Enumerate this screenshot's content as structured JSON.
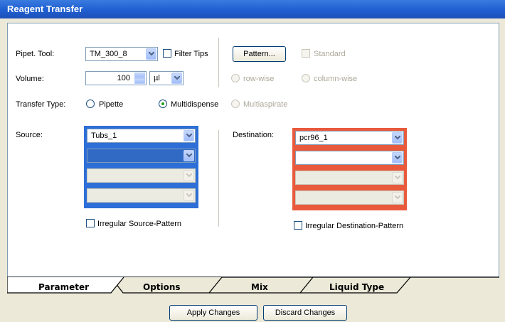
{
  "window": {
    "title": "Reagent Transfer"
  },
  "pipet_tool": {
    "label": "Pipet. Tool:",
    "value": "TM_300_8",
    "filter_tips_label": "Filter Tips"
  },
  "volume": {
    "label": "Volume:",
    "value": "100",
    "unit": "µl"
  },
  "pattern": {
    "button_label": "Pattern...",
    "standard_label": "Standard",
    "row_wise_label": "row-wise",
    "column_wise_label": "column-wise"
  },
  "transfer_type": {
    "label": "Transfer Type:",
    "pipette": "Pipette",
    "multidispense": "Multidispense",
    "multiaspirate": "Multiaspirate",
    "selected": "Multidispense"
  },
  "source": {
    "label": "Source:",
    "values": [
      "Tubs_1",
      "",
      "",
      ""
    ],
    "irregular_label": "Irregular Source-Pattern"
  },
  "destination": {
    "label": "Destination:",
    "values": [
      "pcr96_1",
      "",
      "",
      ""
    ],
    "irregular_label": "Irregular Destination-Pattern"
  },
  "tabs": [
    {
      "label": "Parameter",
      "active": true
    },
    {
      "label": "Options",
      "active": false
    },
    {
      "label": "Mix",
      "active": false
    },
    {
      "label": "Liquid Type",
      "active": false
    }
  ],
  "actions": {
    "apply": "Apply Changes",
    "discard": "Discard Changes"
  },
  "colors": {
    "title_bar": "#1f5fd0",
    "source_accent": "#2d6fd6",
    "destination_accent": "#e95a3d",
    "radio_selected": "#21a121"
  }
}
